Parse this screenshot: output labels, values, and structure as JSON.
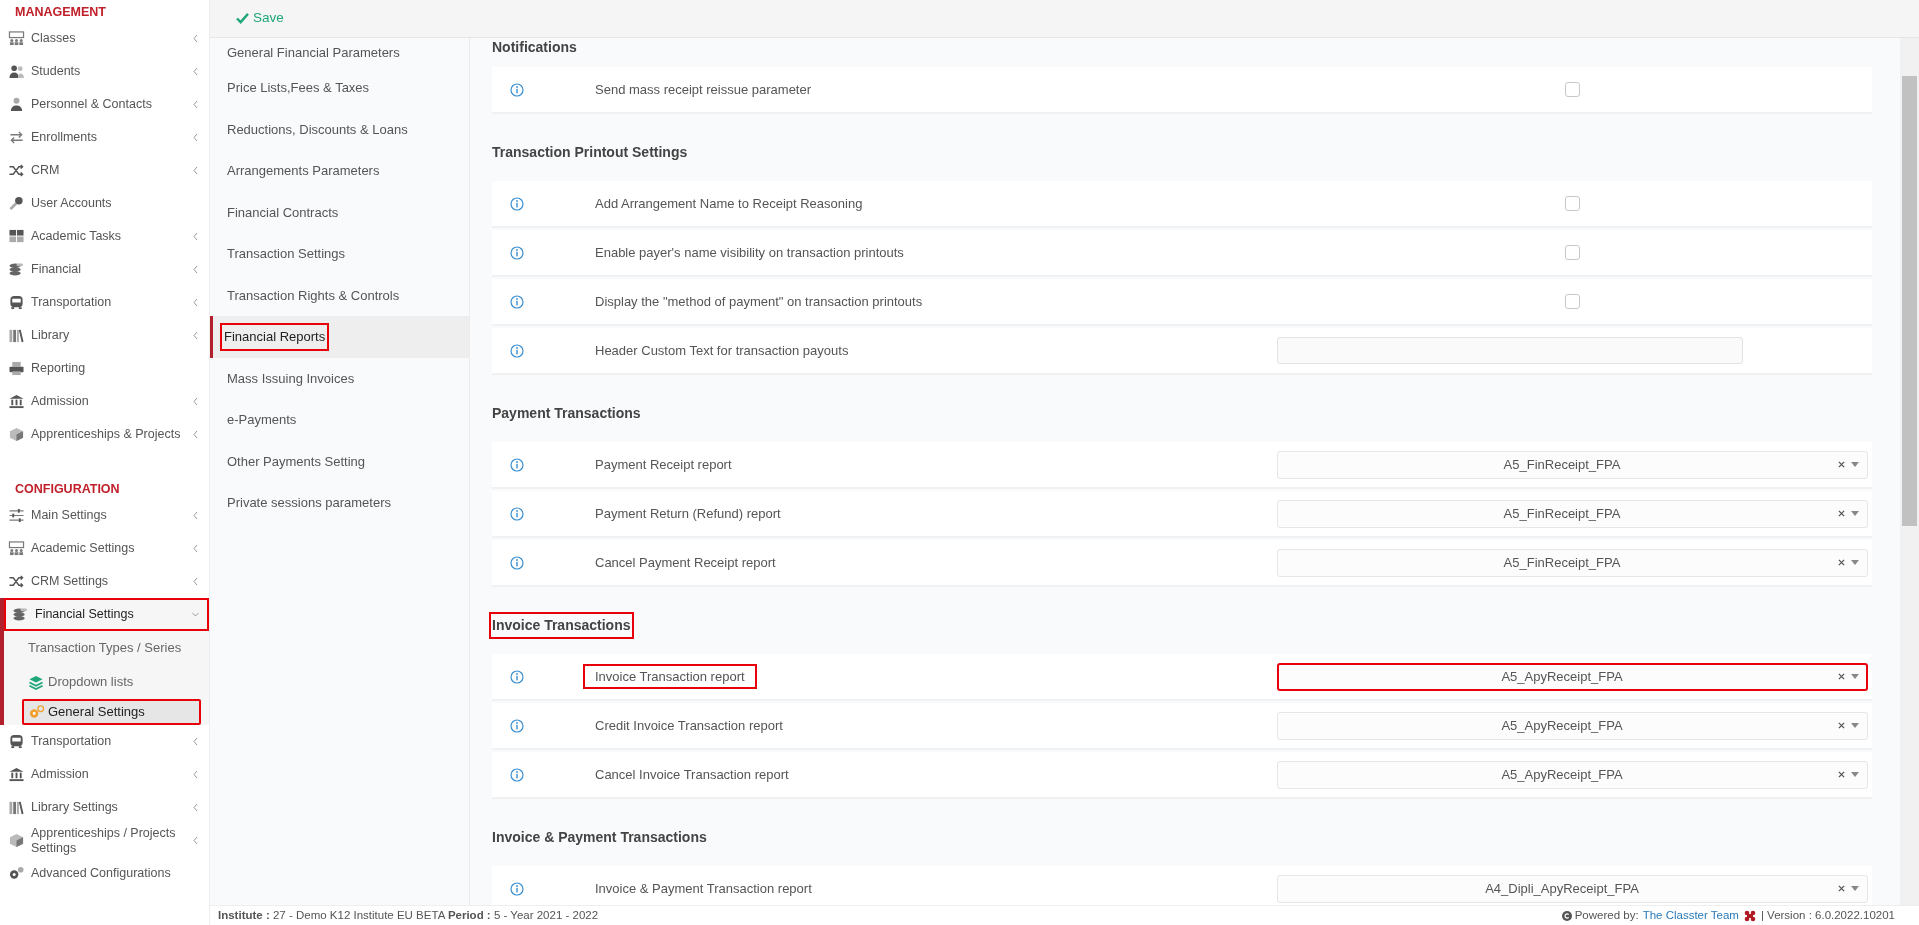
{
  "toolbar": {
    "save": "Save"
  },
  "sidebar": {
    "sections": [
      {
        "title": "MANAGEMENT",
        "items": [
          {
            "label": "Classes",
            "expandable": true,
            "expanded": false,
            "selected": false,
            "highlighted": false
          },
          {
            "label": "Students",
            "expandable": true,
            "expanded": false,
            "selected": false,
            "highlighted": false
          },
          {
            "label": "Personnel & Contacts",
            "expandable": true,
            "expanded": false,
            "selected": false,
            "highlighted": false
          },
          {
            "label": "Enrollments",
            "expandable": true,
            "expanded": false,
            "selected": false,
            "highlighted": false
          },
          {
            "label": "CRM",
            "expandable": true,
            "expanded": false,
            "selected": false,
            "highlighted": false
          },
          {
            "label": "User Accounts",
            "expandable": false,
            "selected": false,
            "highlighted": false
          },
          {
            "label": "Academic Tasks",
            "expandable": true,
            "expanded": false,
            "selected": false,
            "highlighted": false
          },
          {
            "label": "Financial",
            "expandable": true,
            "expanded": false,
            "selected": false,
            "highlighted": false
          },
          {
            "label": "Transportation",
            "expandable": true,
            "expanded": false,
            "selected": false,
            "highlighted": false
          },
          {
            "label": "Library",
            "expandable": true,
            "expanded": false,
            "selected": false,
            "highlighted": false
          },
          {
            "label": "Reporting",
            "expandable": false,
            "selected": false,
            "highlighted": false
          },
          {
            "label": "Admission",
            "expandable": true,
            "expanded": false,
            "selected": false,
            "highlighted": false
          },
          {
            "label": "Apprenticeships & Projects",
            "expandable": true,
            "expanded": false,
            "selected": false,
            "highlighted": false
          }
        ]
      },
      {
        "title": "CONFIGURATION",
        "items": [
          {
            "label": "Main Settings",
            "expandable": true,
            "expanded": false,
            "selected": false,
            "highlighted": false
          },
          {
            "label": "Academic Settings",
            "expandable": true,
            "expanded": false,
            "selected": false,
            "highlighted": false
          },
          {
            "label": "CRM Settings",
            "expandable": true,
            "expanded": false,
            "selected": false,
            "highlighted": false
          },
          {
            "label": "Financial Settings",
            "expandable": true,
            "expanded": true,
            "selected": true,
            "highlighted": true,
            "children": [
              {
                "label": "Transaction Types / Series",
                "selected": false,
                "highlighted": false
              },
              {
                "label": "Dropdown lists",
                "selected": false,
                "highlighted": false
              },
              {
                "label": "General Settings",
                "selected": true,
                "highlighted": true
              }
            ]
          },
          {
            "label": "Transportation",
            "expandable": true,
            "expanded": false,
            "selected": false,
            "highlighted": false
          },
          {
            "label": "Admission",
            "expandable": true,
            "expanded": false,
            "selected": false,
            "highlighted": false
          },
          {
            "label": "Library Settings",
            "expandable": true,
            "expanded": false,
            "selected": false,
            "highlighted": false
          },
          {
            "label": "Apprenticeships / Projects Settings",
            "expandable": true,
            "expanded": false,
            "selected": false,
            "highlighted": false
          },
          {
            "label": "Advanced Configurations",
            "expandable": false,
            "selected": false,
            "highlighted": false
          }
        ]
      }
    ]
  },
  "settings_nav": [
    {
      "label": "General Financial Parameters",
      "selected": false,
      "highlighted": false
    },
    {
      "label": "Price Lists,Fees & Taxes",
      "selected": false,
      "highlighted": false
    },
    {
      "label": "Reductions, Discounts & Loans",
      "selected": false,
      "highlighted": false
    },
    {
      "label": "Arrangements Parameters",
      "selected": false,
      "highlighted": false
    },
    {
      "label": "Financial Contracts",
      "selected": false,
      "highlighted": false
    },
    {
      "label": "Transaction Settings",
      "selected": false,
      "highlighted": false
    },
    {
      "label": "Transaction Rights & Controls",
      "selected": false,
      "highlighted": false
    },
    {
      "label": "Financial Reports",
      "selected": true,
      "highlighted": true
    },
    {
      "label": "Mass Issuing Invoices",
      "selected": false,
      "highlighted": false
    },
    {
      "label": "e-Payments",
      "selected": false,
      "highlighted": false
    },
    {
      "label": "Other Payments Setting",
      "selected": false,
      "highlighted": false
    },
    {
      "label": "Private sessions parameters",
      "selected": false,
      "highlighted": false
    }
  ],
  "sections": [
    {
      "title": "Notifications",
      "highlighted": false,
      "rows": [
        {
          "label": "Send mass receipt reissue parameter",
          "highlighted": false,
          "kind": "checkbox",
          "checked": false
        }
      ]
    },
    {
      "title": "Transaction Printout Settings",
      "highlighted": false,
      "rows": [
        {
          "label": "Add Arrangement Name to Receipt Reasoning",
          "highlighted": false,
          "kind": "checkbox",
          "checked": false
        },
        {
          "label": "Enable payer's name visibility on transaction printouts",
          "highlighted": false,
          "kind": "checkbox",
          "checked": false
        },
        {
          "label": "Display the \"method of payment\" on transaction printouts",
          "highlighted": false,
          "kind": "checkbox",
          "checked": false
        },
        {
          "label": "Header Custom Text for transaction payouts",
          "highlighted": false,
          "kind": "text"
        }
      ]
    },
    {
      "title": "Payment Transactions",
      "highlighted": false,
      "rows": [
        {
          "label": "Payment Receipt report",
          "highlighted": false,
          "kind": "select",
          "value": "A5_FinReceipt_FPA",
          "control_highlighted": false
        },
        {
          "label": "Payment Return (Refund) report",
          "highlighted": false,
          "kind": "select",
          "value": "A5_FinReceipt_FPA",
          "control_highlighted": false
        },
        {
          "label": "Cancel Payment Receipt report",
          "highlighted": false,
          "kind": "select",
          "value": "A5_FinReceipt_FPA",
          "control_highlighted": false
        }
      ]
    },
    {
      "title": "Invoice Transactions",
      "highlighted": true,
      "rows": [
        {
          "label": "Invoice Transaction report",
          "highlighted": true,
          "kind": "select",
          "value": "A5_ApyReceipt_FPA",
          "control_highlighted": true
        },
        {
          "label": "Credit Invoice Transaction report",
          "highlighted": false,
          "kind": "select",
          "value": "A5_ApyReceipt_FPA",
          "control_highlighted": false
        },
        {
          "label": "Cancel Invoice Transaction report",
          "highlighted": false,
          "kind": "select",
          "value": "A5_ApyReceipt_FPA",
          "control_highlighted": false
        }
      ]
    },
    {
      "title": "Invoice & Payment Transactions",
      "highlighted": false,
      "rows": [
        {
          "label": "Invoice & Payment Transaction report",
          "highlighted": false,
          "kind": "select",
          "value": "A4_Dipli_ApyReceipt_FPA",
          "control_highlighted": false
        }
      ]
    }
  ],
  "status_bar": {
    "info": "**Institute :** 27 - Demo K12 Institute EU BETA **Period :** 5 - Year 2021 - 2022",
    "powered_by": "Powered by:",
    "team_link": "The Classter Team",
    "version": "| Version : 6.0.2022.10201"
  }
}
